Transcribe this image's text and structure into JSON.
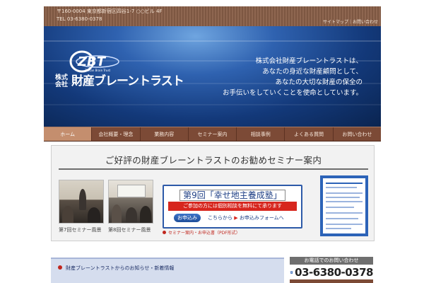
{
  "header": {
    "address_line1": "〒160-0004 東京都新宿区四谷1-7 ○○ビル 4F",
    "address_line2": "TEL 03-6380-0378",
    "sitemap_label": "サイトマップ｜お問い合わせ"
  },
  "hero": {
    "logo_mark": "ZBT",
    "logo_sub": "Zaisan Brain Trust",
    "logo_small": "株式会社",
    "logo_name": "財産ブレーントラスト",
    "tagline": [
      "株式会社財産ブレーントラストは、",
      "あなたの身近な財産顧問として、",
      "あなたの大切な財産の保全の",
      "お手伝いをしていくことを使命としています。"
    ]
  },
  "nav": {
    "items": [
      {
        "label": "ホーム",
        "active": true
      },
      {
        "label": "会社概要・理念"
      },
      {
        "label": "業務内容"
      },
      {
        "label": "セミナー案内"
      },
      {
        "label": "相談事例"
      },
      {
        "label": "よくある質問"
      },
      {
        "label": "お問い合わせ"
      }
    ]
  },
  "seminar": {
    "title": "ご好評の財産ブレーントラストのお勧めセミナー案内",
    "photos": [
      {
        "caption": "第7回セミナー風景"
      },
      {
        "caption": "第8回セミナー風景"
      }
    ],
    "banner": {
      "title": "第9回「幸せ地主養成塾」",
      "red_text": "ご参加の方には個別相談を無料にて承ります",
      "apply_button": "お申込み",
      "apply_link_prefix": "こちらから",
      "apply_link": "お申込みフォームへ"
    },
    "pdf_link": "セミナー案内・お申込書（PDF形式）"
  },
  "news": {
    "heading": "財産ブレーントラストからのお知らせ・新着情報"
  },
  "contact": {
    "heading": "お電話でのお問い合わせ",
    "tel": "03-6380-0378"
  },
  "colors": {
    "nav_bg": "#7c4a36",
    "accent_blue": "#2d5aa8",
    "accent_red": "#d7261e"
  }
}
